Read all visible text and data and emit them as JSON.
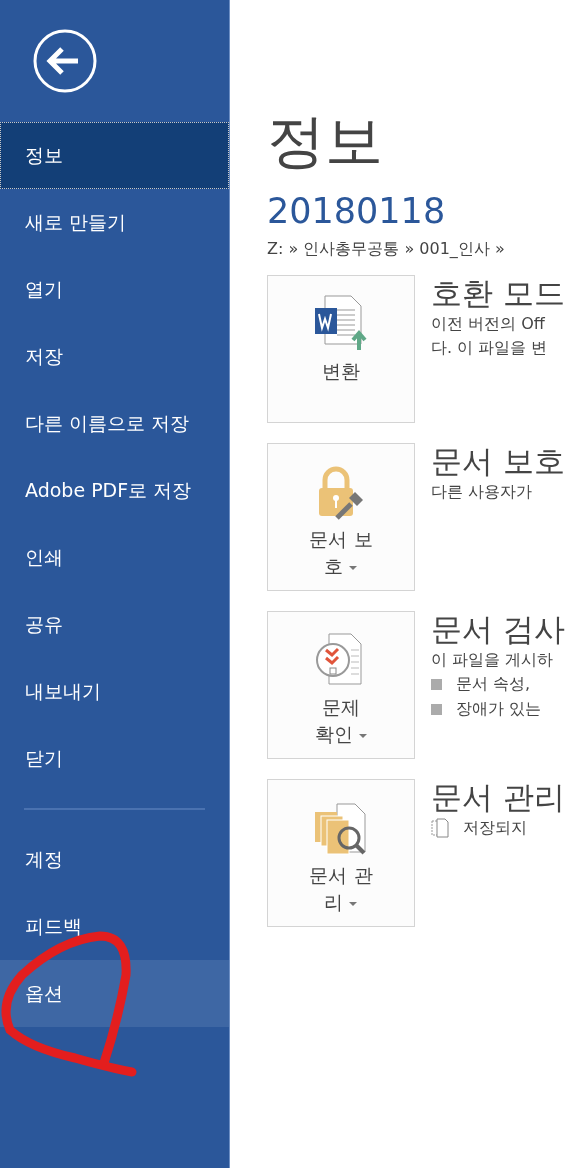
{
  "sidebar": {
    "sections": [
      {
        "items": [
          {
            "label": "정보",
            "selected": true,
            "highlighted": false
          },
          {
            "label": "새로 만들기",
            "selected": false,
            "highlighted": false
          },
          {
            "label": "열기",
            "selected": false,
            "highlighted": false
          },
          {
            "label": "저장",
            "selected": false,
            "highlighted": false
          },
          {
            "label": "다른 이름으로 저장",
            "selected": false,
            "highlighted": false
          },
          {
            "label": "Adobe PDF로 저장",
            "selected": false,
            "highlighted": false
          },
          {
            "label": "인쇄",
            "selected": false,
            "highlighted": false
          },
          {
            "label": "공유",
            "selected": false,
            "highlighted": false
          },
          {
            "label": "내보내기",
            "selected": false,
            "highlighted": false
          },
          {
            "label": "닫기",
            "selected": false,
            "highlighted": false
          }
        ]
      },
      {
        "items": [
          {
            "label": "계정",
            "selected": false,
            "highlighted": false
          },
          {
            "label": "피드백",
            "selected": false,
            "highlighted": false
          },
          {
            "label": "옵션",
            "selected": false,
            "highlighted": true
          }
        ]
      }
    ]
  },
  "main": {
    "title": "정보",
    "document_name": "20180118",
    "path": "Z: » 인사총무공통 » 001_인사 »",
    "sections": [
      {
        "button_lines": [
          "변환"
        ],
        "dropdown": false,
        "heading": "호환 모드",
        "lines": [
          {
            "kind": "text",
            "text": "이전 버전의 Off"
          },
          {
            "kind": "text",
            "text": "다. 이 파일을 변"
          }
        ]
      },
      {
        "button_lines": [
          "문서 보",
          "호"
        ],
        "dropdown": true,
        "heading": "문서 보호",
        "lines": [
          {
            "kind": "text",
            "text": "다른 사용자가"
          }
        ]
      },
      {
        "button_lines": [
          "문제",
          "확인"
        ],
        "dropdown": true,
        "heading": "문서 검사",
        "lines": [
          {
            "kind": "text",
            "text": "이 파일을 게시하"
          },
          {
            "kind": "bullet",
            "text": "문서 속성,"
          },
          {
            "kind": "bullet",
            "text": "장애가 있는"
          }
        ]
      },
      {
        "button_lines": [
          "문서 관",
          "리"
        ],
        "dropdown": true,
        "heading": "문서 관리",
        "lines": [
          {
            "kind": "doc",
            "text": "저장되지"
          }
        ]
      }
    ]
  }
}
